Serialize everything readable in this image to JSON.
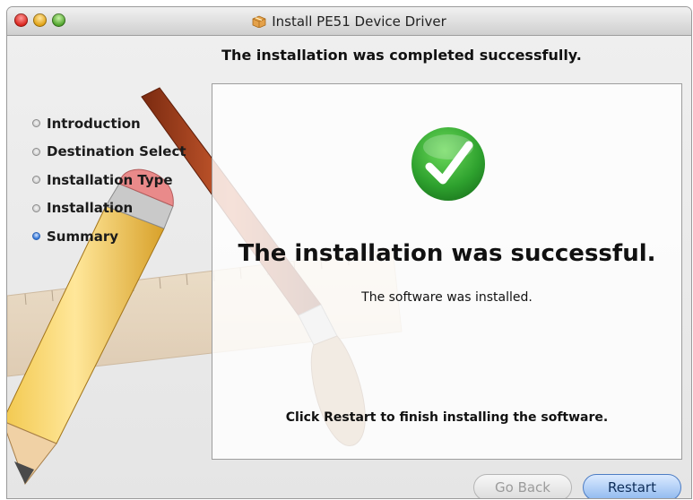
{
  "window": {
    "title": "Install PE51 Device Driver",
    "icon": "package-icon"
  },
  "header": {
    "heading": "The installation was completed successfully."
  },
  "sidebar": {
    "steps": [
      {
        "label": "Introduction",
        "active": false
      },
      {
        "label": "Destination Select",
        "active": false
      },
      {
        "label": "Installation Type",
        "active": false
      },
      {
        "label": "Installation",
        "active": false
      },
      {
        "label": "Summary",
        "active": true
      }
    ]
  },
  "main": {
    "status_icon": "checkmark-icon",
    "success_title": "The installation was successful.",
    "success_subtitle": "The software was installed.",
    "instruction": "Click Restart to finish installing the software."
  },
  "buttons": {
    "back_label": "Go Back",
    "restart_label": "Restart"
  },
  "colors": {
    "success_green": "#2ea12e",
    "active_step_blue": "#2f73d6",
    "default_button_blue": "#8fb9ef"
  }
}
